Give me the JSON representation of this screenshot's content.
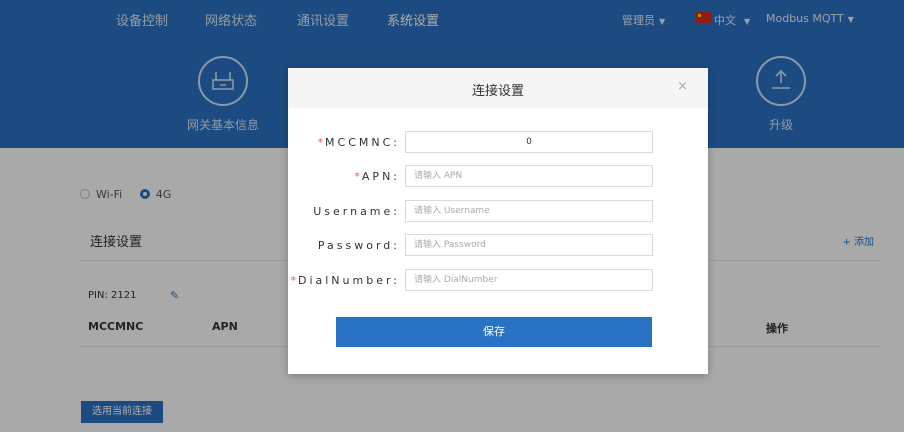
{
  "header": {
    "nav": [
      "设备控制",
      "网络状态",
      "通讯设置",
      "系统设置"
    ],
    "user": "管理员",
    "language": "中文",
    "protocol": "Modbus MQTT"
  },
  "features": [
    {
      "label": "网关基本信息",
      "icon": "router-icon"
    },
    {
      "label": "升级",
      "icon": "upload-icon"
    }
  ],
  "page": {
    "radio_wifi": "Wi-Fi",
    "radio_4g": "4G",
    "section_title": "连接设置",
    "add_label": "+ 添加",
    "pin": "PIN:  2121",
    "columns": [
      "MCCMNC",
      "APN",
      "操作"
    ],
    "use_button": "选用当前连接"
  },
  "modal": {
    "title": "连接设置",
    "close": "×",
    "fields": [
      {
        "label": "MCCMNC:",
        "required": true,
        "value": "0",
        "placeholder": ""
      },
      {
        "label": "APN:",
        "required": true,
        "value": "",
        "placeholder": "请输入 APN"
      },
      {
        "label": "Username:",
        "required": false,
        "value": "",
        "placeholder": "请输入 Username"
      },
      {
        "label": "Password:",
        "required": false,
        "value": "",
        "placeholder": "请输入 Password"
      },
      {
        "label": "DialNumber:",
        "required": true,
        "value": "",
        "placeholder": "请输入 DialNumber"
      }
    ],
    "save_label": "保存"
  },
  "colors": {
    "primary": "#2a6fbe",
    "required": "#e55555"
  }
}
